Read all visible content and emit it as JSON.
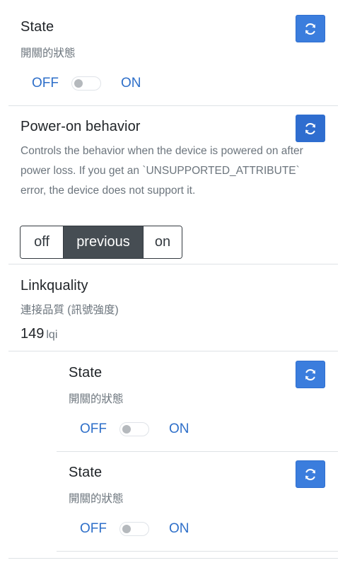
{
  "state_main": {
    "title": "State",
    "subtitle": "開關的狀態",
    "off_label": "OFF",
    "on_label": "ON",
    "value": "OFF"
  },
  "power_on": {
    "title": "Power-on behavior",
    "description": "Controls the behavior when the device is powered on after power loss. If you get an `UNSUPPORTED_ATTRIBUTE` error, the device does not support it.",
    "options": [
      "off",
      "previous",
      "on"
    ],
    "selected": "previous"
  },
  "linkquality": {
    "title": "Linkquality",
    "subtitle": "連接品質 (訊號強度)",
    "value": "149",
    "unit": "lqi"
  },
  "state_l1": {
    "title": "State",
    "subtitle": "開關的狀態",
    "off_label": "OFF",
    "on_label": "ON",
    "value": "OFF"
  },
  "state_l2": {
    "title": "State",
    "subtitle": "開關的狀態",
    "off_label": "OFF",
    "on_label": "ON",
    "value": "OFF"
  },
  "colors": {
    "accent": "#3b7ddd",
    "link": "#2e6fc9",
    "muted_text": "#6c757d",
    "active_segment": "#464d53"
  },
  "icons": {
    "refresh": "refresh-icon"
  }
}
